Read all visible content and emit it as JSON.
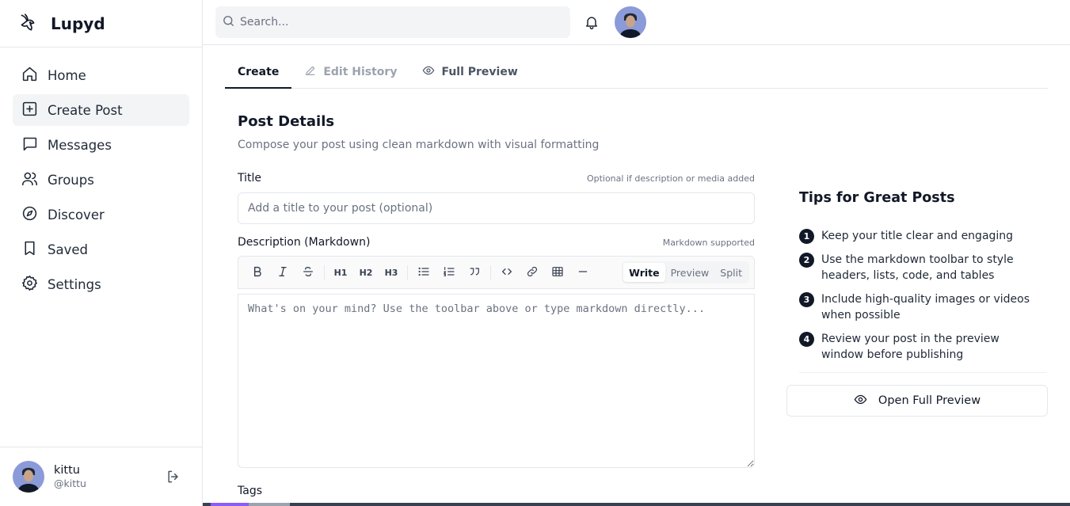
{
  "brand": {
    "name": "Lupyd"
  },
  "nav": [
    {
      "label": "Home",
      "icon": "home-icon"
    },
    {
      "label": "Create Post",
      "icon": "plus-square-icon",
      "active": true
    },
    {
      "label": "Messages",
      "icon": "message-icon"
    },
    {
      "label": "Groups",
      "icon": "users-icon"
    },
    {
      "label": "Discover",
      "icon": "compass-icon"
    },
    {
      "label": "Saved",
      "icon": "bookmark-icon"
    },
    {
      "label": "Settings",
      "icon": "gear-icon"
    }
  ],
  "profile": {
    "name": "kittu",
    "handle": "@kittu"
  },
  "search": {
    "placeholder": "Search..."
  },
  "tabs": [
    {
      "label": "Create",
      "state": "active"
    },
    {
      "label": "Edit History",
      "state": "disabled"
    },
    {
      "label": "Full Preview",
      "state": "normal"
    }
  ],
  "form": {
    "title": "Post Details",
    "subtitle": "Compose your post using clean markdown with visual formatting",
    "title_label": "Title",
    "title_hint": "Optional if description or media added",
    "title_placeholder": "Add a title to your post (optional)",
    "desc_label": "Description (Markdown)",
    "desc_hint": "Markdown supported",
    "desc_placeholder": "What's on your mind? Use the toolbar above or type markdown directly...",
    "tags_label": "Tags",
    "toolbar": {
      "h1": "H1",
      "h2": "H2",
      "h3": "H3"
    },
    "modes": [
      {
        "label": "Write",
        "active": true
      },
      {
        "label": "Preview",
        "active": false
      },
      {
        "label": "Split",
        "active": false
      }
    ]
  },
  "tips": {
    "title": "Tips for Great Posts",
    "items": [
      {
        "num": "1",
        "text": "Keep your title clear and engaging"
      },
      {
        "num": "2",
        "text": "Use the markdown toolbar to style headers, lists, code, and tables"
      },
      {
        "num": "3",
        "text": "Include high-quality images or videos when possible"
      },
      {
        "num": "4",
        "text": "Review your post in the preview window before publishing"
      }
    ],
    "preview_button": "Open Full Preview"
  },
  "colors": {
    "accent": "#111827",
    "muted": "#6b7280",
    "border": "#e5e7eb"
  }
}
